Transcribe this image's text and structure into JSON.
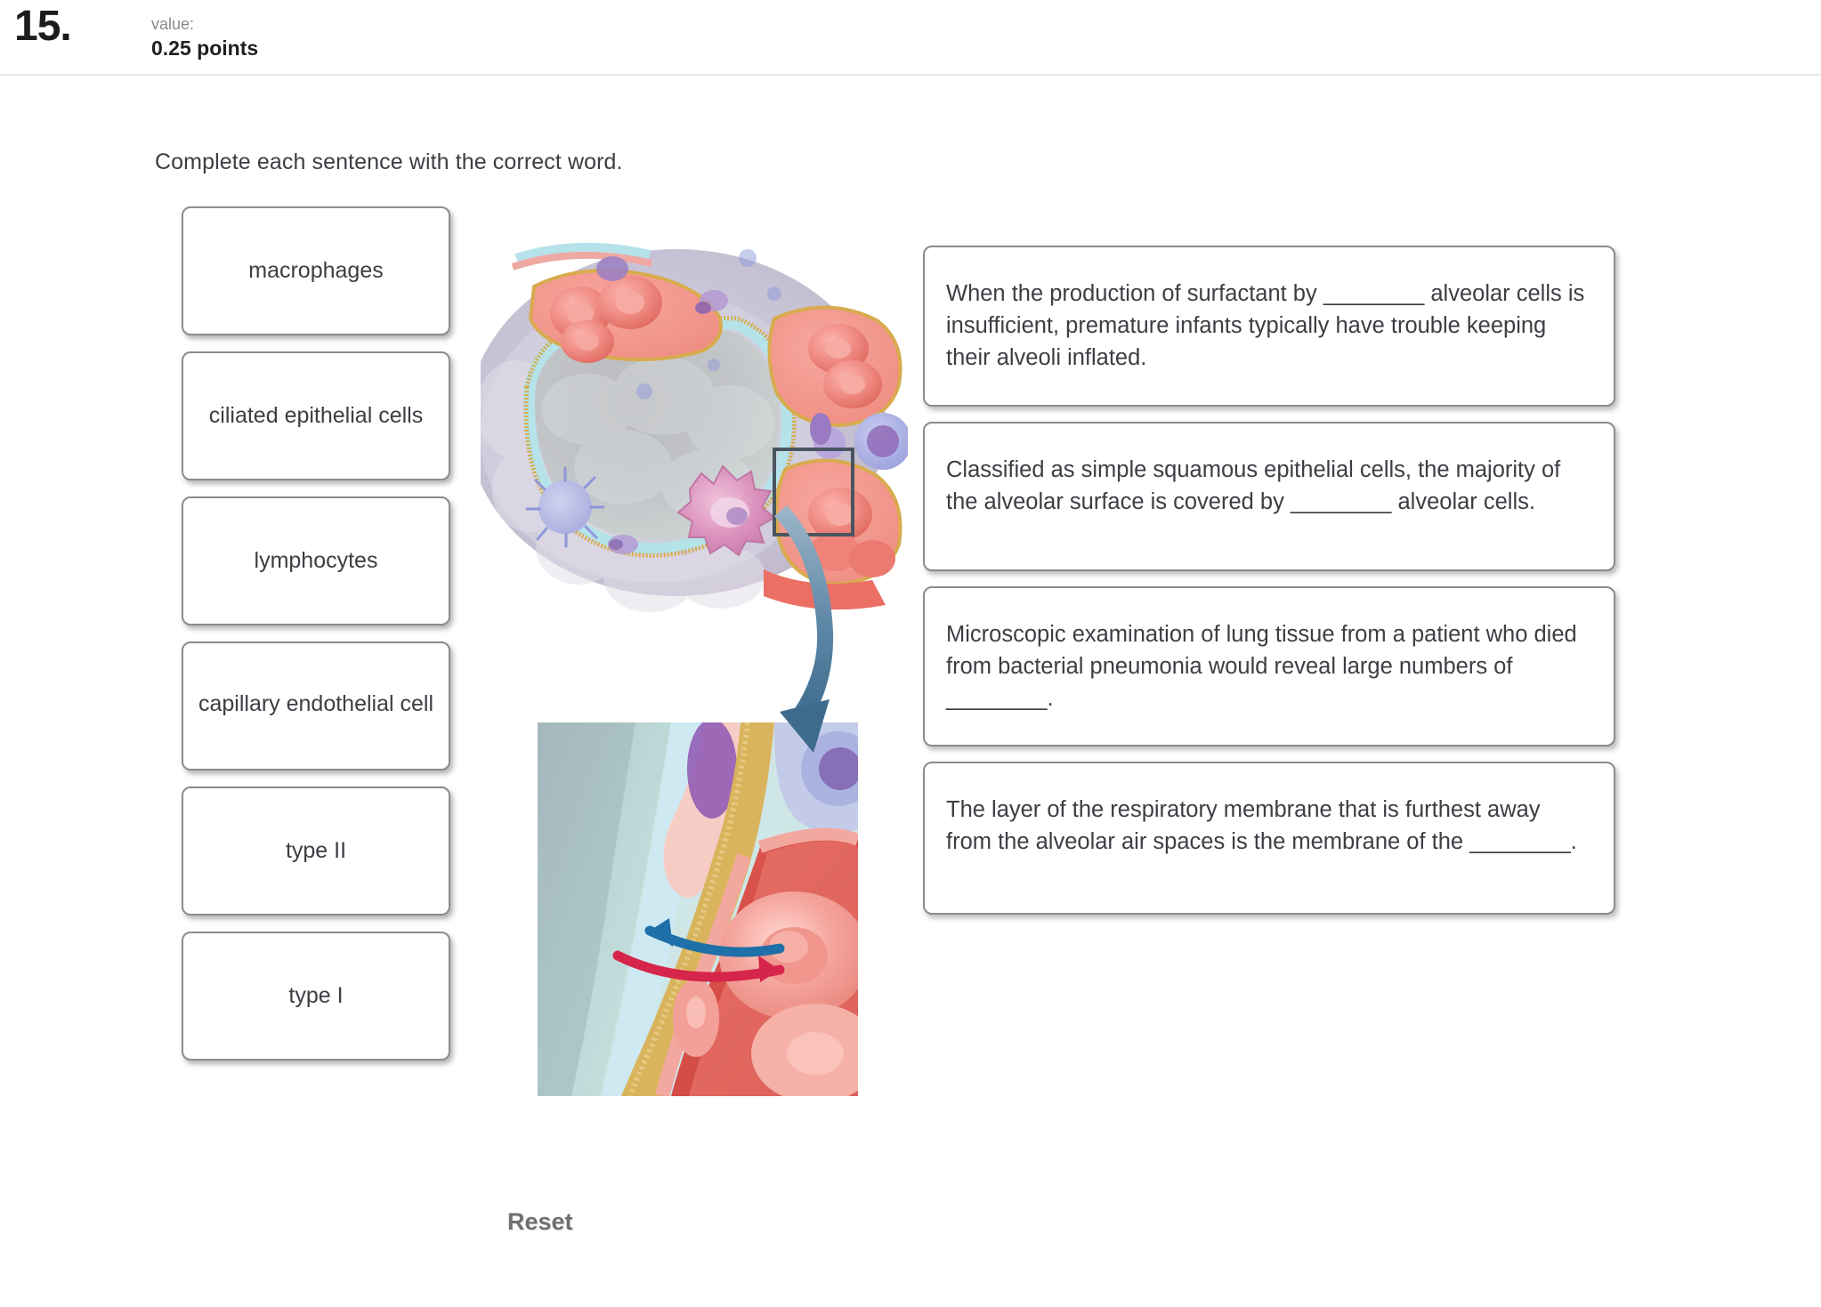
{
  "header": {
    "question_number": "15.",
    "value_label": "value:",
    "value_points": "0.25 points"
  },
  "instruction": "Complete each sentence with the correct word.",
  "word_bank": {
    "items": [
      {
        "label": "macrophages"
      },
      {
        "label": "ciliated epithelial cells"
      },
      {
        "label": "lymphocytes"
      },
      {
        "label": "capillary endothelial cell"
      },
      {
        "label": "type II"
      },
      {
        "label": "type I"
      }
    ]
  },
  "reset": {
    "label": "Reset"
  },
  "questions": [
    {
      "text": "When the production of surfactant by ________ alveolar cells is insufficient, premature infants typically have trouble keeping their alveoli inflated."
    },
    {
      "text": "Classified as simple squamous epithelial cells, the majority of the alveolar surface is covered by ________ alveolar cells."
    },
    {
      "text": "Microscopic examination of lung tissue from a patient who died from bacterial pneumonia would reveal large numbers of ________."
    },
    {
      "text": "The layer of the respiratory membrane that is furthest away from the alveolar air spaces is the membrane of the ________."
    }
  ],
  "illustration": {
    "alveolus_caption": "alveolus-cross-section-illustration",
    "magnified_caption": "respiratory-membrane-magnified-illustration",
    "inset_box_label": "magnification-selection-box",
    "connector_label": "magnification-connector-arrow",
    "gas_arrows": {
      "oxygen_color": "#1f6fa8",
      "carbon_dioxide_color": "#d6254b"
    }
  }
}
